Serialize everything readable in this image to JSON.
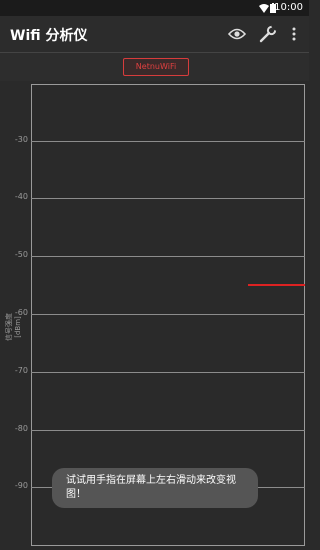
{
  "status": {
    "time": "10:00"
  },
  "app": {
    "title": "Wifi 分析仪"
  },
  "toolbar": {
    "icons": [
      "eye-icon",
      "wrench-icon",
      "more-vert-icon"
    ]
  },
  "network_chip": {
    "label": "NetnuWiFi",
    "color": "#e04040"
  },
  "graph": {
    "y_axis_label": "信号强度 [dBm]",
    "ticks": [
      "-30",
      "-40",
      "-50",
      "-60",
      "-70",
      "-80",
      "-90"
    ],
    "signal_level_dbm": -55
  },
  "toast": {
    "text": "试试用手指在屏幕上左右滑动来改变视图！"
  }
}
